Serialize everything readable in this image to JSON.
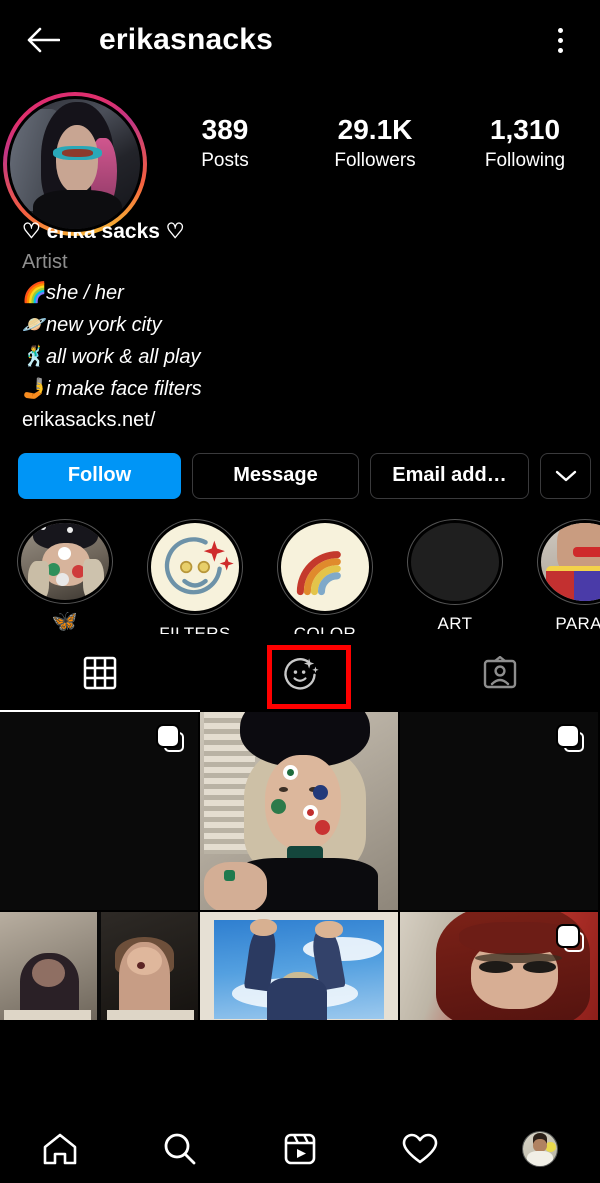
{
  "header": {
    "back_icon": "back-arrow-icon",
    "title": "erikasnacks",
    "menu_icon": "kebab-menu-icon"
  },
  "profile": {
    "avatar_label": "profile-picture",
    "stats": [
      {
        "value": "389",
        "label": "Posts"
      },
      {
        "value": "29.1K",
        "label": "Followers"
      },
      {
        "value": "1,310",
        "label": "Following"
      }
    ],
    "bio": {
      "display_name": "♡ erika sacks ♡",
      "category": "Artist",
      "lines": [
        {
          "emoji": "🌈",
          "text": "she / her"
        },
        {
          "emoji": "🪐",
          "text": "new york city"
        },
        {
          "emoji": "🕺",
          "text": "all work & all play"
        },
        {
          "emoji": "🤳",
          "text": "i make face filters"
        }
      ],
      "link": "erikasacks.net/"
    }
  },
  "actions": {
    "follow_label": "Follow",
    "message_label": "Message",
    "email_label": "Email add…",
    "chevron_icon": "chevron-down-icon",
    "follow_color": "#0095f6"
  },
  "highlights": [
    {
      "label": "🦋",
      "cover": "photo-face-paint",
      "is_emoji": true
    },
    {
      "label": "FILTERS",
      "cover": "smiley-sparkles",
      "is_emoji": false
    },
    {
      "label": "COLOR",
      "cover": "rainbow",
      "is_emoji": false
    },
    {
      "label": "ART",
      "cover": "dark",
      "is_emoji": false
    },
    {
      "label": "PARAD",
      "cover": "photo-parade",
      "is_emoji": false
    }
  ],
  "tabs": [
    {
      "icon": "grid-icon",
      "active": true
    },
    {
      "icon": "effects-smiley-icon",
      "active": false,
      "highlighted": true
    },
    {
      "icon": "tagged-person-icon",
      "active": false
    }
  ],
  "tab_highlight_color": "#ff0000",
  "grid": {
    "row1": [
      {
        "name": "post-dark-left",
        "carousel": true
      },
      {
        "name": "post-beret-flowers",
        "carousel": false
      },
      {
        "name": "post-dark-right",
        "carousel": true
      }
    ],
    "row2": [
      {
        "name": "post-video-call",
        "carousel": false
      },
      {
        "name": "post-sky-arms-up",
        "carousel": false
      },
      {
        "name": "post-red-hair-cat-ears",
        "carousel": true
      }
    ]
  },
  "bottom_nav": [
    {
      "icon": "home-icon"
    },
    {
      "icon": "search-icon"
    },
    {
      "icon": "reels-icon"
    },
    {
      "icon": "heart-activity-icon"
    },
    {
      "icon": "profile-avatar-icon"
    }
  ]
}
